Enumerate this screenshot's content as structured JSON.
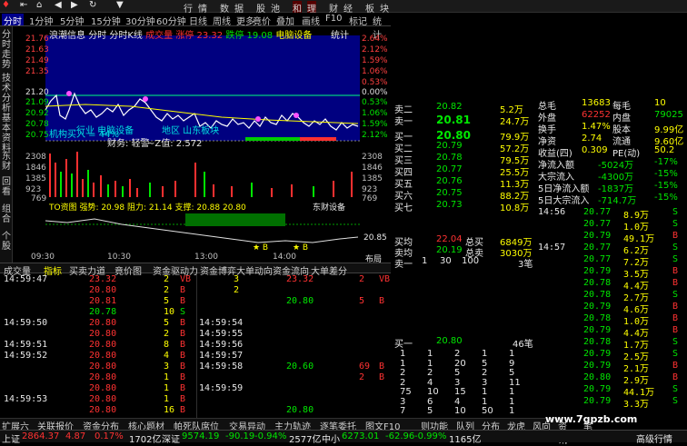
{
  "menu": [
    "行",
    "情",
    "数",
    "据",
    "股",
    "池",
    "和",
    "理",
    "财",
    "经",
    "板",
    "块"
  ],
  "tabs": [
    "分时",
    "1分钟",
    "5分钟",
    "15分钟",
    "30分钟",
    "60分钟",
    "日线",
    "周线",
    "更多",
    "竟价",
    "叠加",
    "画线",
    "F10",
    "标记",
    "统计"
  ],
  "left_tabs": [
    "分时走势",
    "技术分析",
    "基本资料",
    "东财",
    "回看",
    "组合",
    "个股"
  ],
  "chart": {
    "header": [
      "浪潮信息",
      "分时",
      "分时K线",
      "成交量",
      "涨停",
      "23.32",
      "跌停",
      "19.08",
      "电脑设备",
      "统计"
    ],
    "left_ticks": [
      "21.76",
      "21.63",
      "21.49",
      "21.35",
      "21.20",
      "21.09",
      "20.92",
      "20.78",
      "20.75"
    ],
    "right_ticks": [
      "2.64%",
      "2.12%",
      "1.59%",
      "1.06%",
      "0.53%",
      "0.00%",
      "0.53%",
      "1.06%",
      "1.59%",
      "2.12%"
    ],
    "vol_left": [
      "2308",
      "1846",
      "1385",
      "923",
      "769"
    ],
    "vol_right": [
      "2308",
      "1846",
      "1385",
      "923",
      "769"
    ],
    "overlay_industry": "行业  电脑设备",
    "overlay_inst": "机构买入 = 44%",
    "overlay_fin": "财务: 轻警",
    "overlay_z": "~Z值: 2.572",
    "overlay_region": "地区 山东板块",
    "ind_header": "TO资图   强势: 20.98  阻力: 21.14  支撑: 20.88  20.80",
    "ind_right": "东财设备",
    "ind_tick": "20.85",
    "times": [
      "09:30",
      "10:30",
      "13:00",
      "14:00",
      "布局"
    ]
  },
  "bottom_tabs": [
    "成交量",
    "指标",
    "买卖力道",
    "竟价图",
    "资金驱动力",
    "资金博弈",
    "大单动向",
    "资金流向",
    "大单差分"
  ],
  "trades_left": [
    {
      "t": "14:59:47",
      "p": "23.32",
      "v": "2",
      "f": "VB",
      "pc": "red"
    },
    {
      "t": "",
      "p": "20.80",
      "v": "2",
      "f": "B",
      "pc": "red"
    },
    {
      "t": "",
      "p": "20.81",
      "v": "5",
      "f": "B",
      "pc": "red"
    },
    {
      "t": "",
      "p": "20.78",
      "v": "10",
      "f": "S",
      "pc": "grn"
    },
    {
      "t": "14:59:50",
      "p": "20.80",
      "v": "5",
      "f": "B",
      "pc": "red"
    },
    {
      "t": "",
      "p": "20.80",
      "v": "2",
      "f": "B",
      "pc": "red"
    },
    {
      "t": "14:59:51",
      "p": "20.80",
      "v": "8",
      "f": "B",
      "pc": "red"
    },
    {
      "t": "14:59:52",
      "p": "20.80",
      "v": "4",
      "f": "B",
      "pc": "red"
    },
    {
      "t": "",
      "p": "20.80",
      "v": "3",
      "f": "B",
      "pc": "red"
    },
    {
      "t": "",
      "p": "20.80",
      "v": "1",
      "f": "B",
      "pc": "red"
    },
    {
      "t": "",
      "p": "20.80",
      "v": "1",
      "f": "B",
      "pc": "red"
    },
    {
      "t": "14:59:53",
      "p": "20.80",
      "v": "1",
      "f": "B",
      "pc": "red"
    },
    {
      "t": "",
      "p": "20.80",
      "v": "16",
      "f": "B",
      "pc": "red"
    }
  ],
  "trades_right": [
    {
      "t": "",
      "p": "23.32",
      "v": "2",
      "f": "VB"
    },
    {
      "t": "",
      "p": "",
      "v": "",
      "f": ""
    },
    {
      "t": "",
      "p": "20.80",
      "v": "5",
      "f": "B"
    },
    {
      "t": "",
      "p": "",
      "v": "",
      "f": ""
    },
    {
      "t": "14:59:54",
      "p": "",
      "v": "",
      "f": ""
    },
    {
      "t": "14:59:55",
      "p": "",
      "v": "",
      "f": ""
    },
    {
      "t": "14:59:56",
      "p": "",
      "v": "",
      "f": ""
    },
    {
      "t": "14:59:57",
      "p": "",
      "v": "",
      "f": ""
    },
    {
      "t": "14:59:58",
      "p": "20.60",
      "v": "69",
      "f": "B"
    },
    {
      "t": "",
      "p": "",
      "v": "2",
      "f": "B"
    },
    {
      "t": "14:59:59",
      "p": "",
      "v": "",
      "f": ""
    },
    {
      "t": "",
      "p": "",
      "v": "",
      "f": ""
    },
    {
      "t": "",
      "p": "20.80",
      "v": "",
      "f": ""
    }
  ],
  "trades_right_left_vol": [
    "3",
    "2",
    "",
    "",
    "",
    "",
    "",
    "",
    "",
    "",
    "",
    "",
    ""
  ],
  "sell_orders": [
    {
      "l": "卖二",
      "p": "20.82",
      "v": "5.2万"
    },
    {
      "l": "卖一",
      "p": "20.81",
      "v": "24.7万"
    }
  ],
  "buy_orders": [
    {
      "l": "买一",
      "p": "20.80",
      "v": "79.9万"
    },
    {
      "l": "买二",
      "p": "20.79",
      "v": "57.2万"
    },
    {
      "l": "买三",
      "p": "20.78",
      "v": "79.5万"
    },
    {
      "l": "买四",
      "p": "20.77",
      "v": "25.5万"
    },
    {
      "l": "买五",
      "p": "20.76",
      "v": "11.3万"
    },
    {
      "l": "买六",
      "p": "20.75",
      "v": "88.2万"
    },
    {
      "l": "买七",
      "p": "20.73",
      "v": "10.8万"
    }
  ],
  "summary": [
    {
      "l": "买均",
      "p": "22.04",
      "k": "总买",
      "v": "6849万"
    },
    {
      "l": "卖均",
      "p": "20.19",
      "k": "总卖",
      "v": "3030万"
    }
  ],
  "sell1_row": {
    "l": "卖一",
    "a": "1",
    "b": "30",
    "c": "100",
    "n": "3笔"
  },
  "buy1_row": {
    "l": "买一",
    "p": "20.80",
    "n": "46笔"
  },
  "queue": [
    [
      "1",
      "1",
      "2",
      "1",
      "1"
    ],
    [
      "1",
      "1",
      "20",
      "5",
      "9"
    ],
    [
      "2",
      "2",
      "5",
      "2",
      "5"
    ],
    [
      "2",
      "4",
      "3",
      "3",
      "11"
    ],
    [
      "75",
      "10",
      "15",
      "1",
      "1"
    ],
    [
      "3",
      "6",
      "4",
      "1",
      "1"
    ],
    [
      "7",
      "5",
      "10",
      "50",
      "1"
    ]
  ],
  "stats": [
    {
      "a": "总毛",
      "b": "13683",
      "c": "每毛",
      "d": "10"
    },
    {
      "a": "外盘",
      "b": "62252",
      "c": "内盘",
      "d": "79025"
    },
    {
      "a": "换手",
      "b": "1.47%",
      "c": "股本",
      "d": "9.99亿"
    },
    {
      "a": "净资",
      "b": "2.74",
      "c": "流通",
      "d": "9.60亿"
    },
    {
      "a": "收益(四)",
      "b": "0.309",
      "c": "PE(动)",
      "d": "50.2"
    },
    {
      "a": "净流入额",
      "b": "-5024万",
      "c": "",
      "d": "-17%"
    },
    {
      "a": "大宗流入",
      "b": "-4300万",
      "c": "",
      "d": "-15%"
    },
    {
      "a": "5日净流入额",
      "b": "-1837万",
      "c": "",
      "d": "-15%"
    },
    {
      "a": "5日大宗流入",
      "b": "-714.7万",
      "c": "",
      "d": "-15%"
    }
  ],
  "ticks": [
    {
      "t": "14:56",
      "p": "20.77",
      "v": "8.9万",
      "f": "S"
    },
    {
      "t": "",
      "p": "20.77",
      "v": "1.0万",
      "f": "S"
    },
    {
      "t": "",
      "p": "20.79",
      "v": "49.1万",
      "f": "B"
    },
    {
      "t": "14:57",
      "p": "20.77",
      "v": "6.2万",
      "f": "S"
    },
    {
      "t": "",
      "p": "20.77",
      "v": "7.2万",
      "f": "S"
    },
    {
      "t": "",
      "p": "20.79",
      "v": "3.5万",
      "f": "B"
    },
    {
      "t": "",
      "p": "20.78",
      "v": "4.4万",
      "f": "B"
    },
    {
      "t": "",
      "p": "20.78",
      "v": "2.7万",
      "f": "S"
    },
    {
      "t": "",
      "p": "20.79",
      "v": "4.6万",
      "f": "B"
    },
    {
      "t": "",
      "p": "20.78",
      "v": "1.0万",
      "f": "B"
    },
    {
      "t": "",
      "p": "20.79",
      "v": "4.4万",
      "f": "B"
    },
    {
      "t": "",
      "p": "20.78",
      "v": "1.7万",
      "f": "S"
    },
    {
      "t": "",
      "p": "20.79",
      "v": "2.5万",
      "f": "S"
    },
    {
      "t": "",
      "p": "20.79",
      "v": "2.1万",
      "f": "B"
    },
    {
      "t": "",
      "p": "20.80",
      "v": "2.9万",
      "f": "B"
    },
    {
      "t": "",
      "p": "20.79",
      "v": "44.1万",
      "f": "S"
    },
    {
      "t": "",
      "p": "20.79",
      "v": "3.3万",
      "f": "S"
    }
  ],
  "func_row": [
    "扩展六",
    "关联报价",
    "资金分布",
    "核心题材",
    "帕死队席位",
    "交易异动",
    "主力轨迹",
    "逐笔委托",
    "图文F10",
    "则功能",
    "队列",
    "分布",
    "龙虎",
    "风向",
    "资讯",
    "笔"
  ],
  "status": [
    {
      "k": "上证",
      "v": "2864.37",
      "c": "4.87",
      "p": "0.17%",
      "a": "1702亿"
    },
    {
      "k": "深证",
      "v": "9574.19",
      "c": "-90.19",
      "p": "-0.94%",
      "a": "2577亿"
    },
    {
      "k": "中小",
      "v": "6273.01",
      "c": "-62.96",
      "p": "-0.99%",
      "a": "1165亿"
    }
  ],
  "status_right": "高级行情",
  "watermark": "www.7gpzb.com"
}
